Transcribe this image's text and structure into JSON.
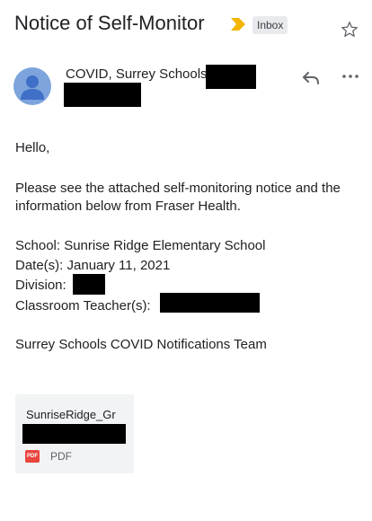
{
  "header": {
    "subject": "Notice of Self-Monitor",
    "label_badge": "Inbox",
    "icons": [
      "importance-marker-icon",
      "star-icon"
    ]
  },
  "sender": {
    "name": "COVID, Surrey Schools",
    "avatar_color": "#7da4dc",
    "icons": [
      "reply-icon",
      "more-icon"
    ]
  },
  "body": {
    "greeting": "Hello,",
    "line1": "Please see the attached self-monitoring notice and the",
    "line2": "information below from Fraser Health.",
    "school": "School:  Sunrise Ridge Elementary School",
    "date": "Date(s):  January 11, 2021",
    "division": "Division:",
    "teacher": "Classroom Teacher(s):",
    "signoff": "Surrey Schools COVID Notifications Team"
  },
  "attachment": {
    "filename": "SunriseRidge_Gr",
    "icon_text": "PDF",
    "type_label": "PDF"
  },
  "colors": {
    "importance": "#f4b400",
    "pdf": "#e8453c"
  }
}
